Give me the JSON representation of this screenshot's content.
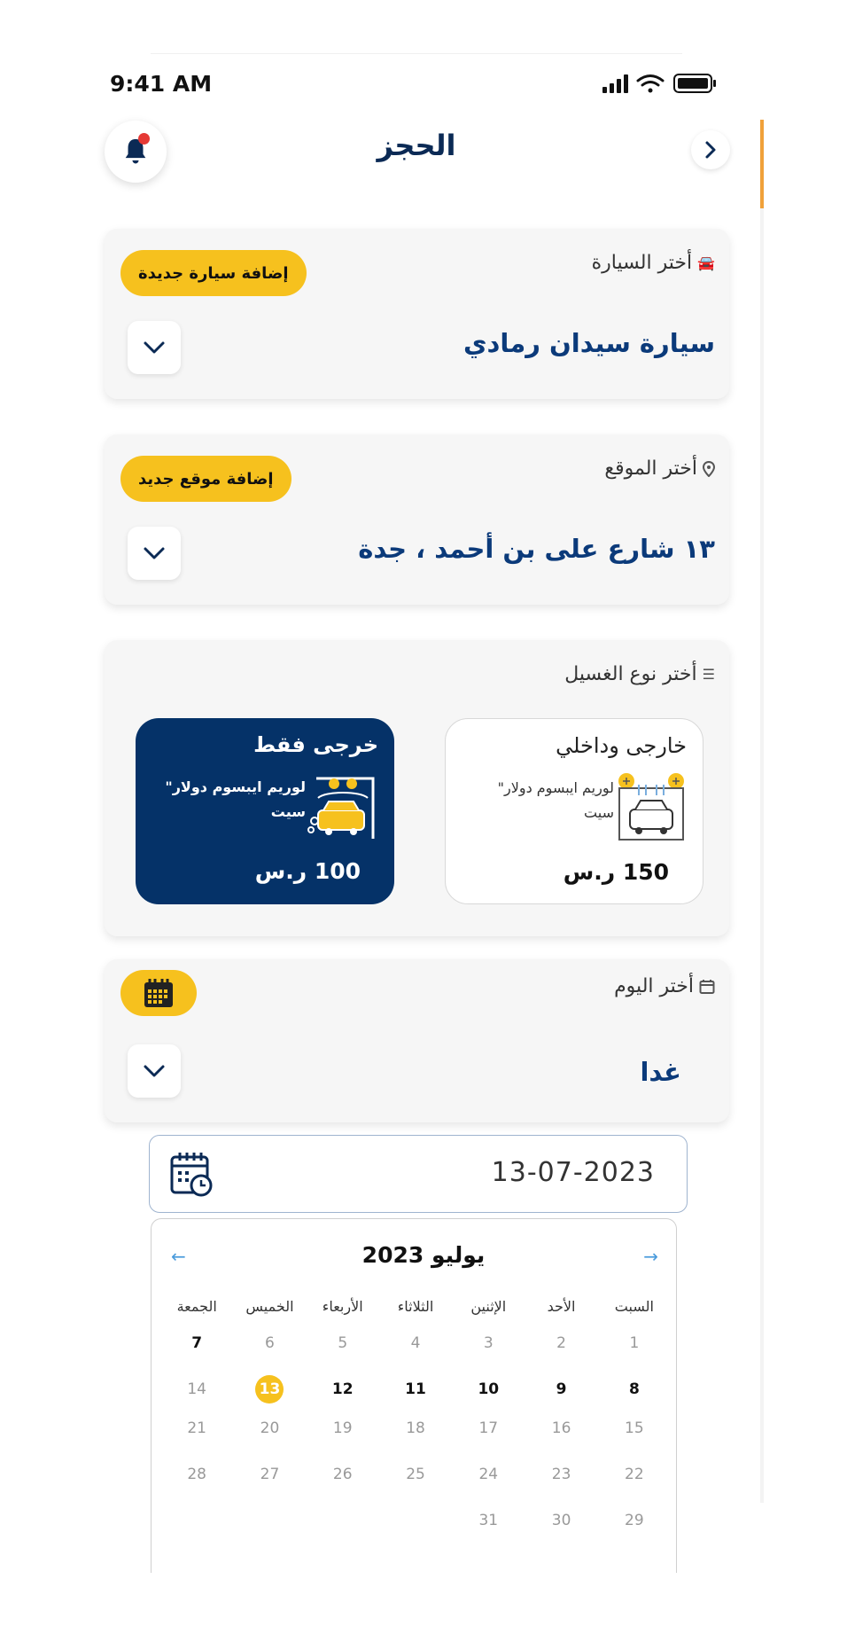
{
  "status_bar": {
    "time": "9:41 AM"
  },
  "header": {
    "title": "الحجز"
  },
  "car": {
    "label": "أختر السيارة",
    "add_label": "إضافة سيارة جديدة",
    "value": "سيارة سيدان رمادي"
  },
  "location": {
    "label": "أختر الموقع",
    "add_label": "إضافة موقع جديد",
    "value": "١٣ شارع على بن أحمد ، جدة"
  },
  "wash_type": {
    "label": "أختر نوع الغسيل",
    "options": [
      {
        "title": "خارجى  وداخلي",
        "desc": "لوريم ايبسوم دولار\" سيت",
        "price": "150 ر.س",
        "selected": false
      },
      {
        "title": "خرجى فقط",
        "desc": "لوريم ايبسوم دولار\" سيت",
        "price": "100 ر.س",
        "selected": true
      }
    ]
  },
  "day": {
    "label": "أختر اليوم",
    "value": "غدا"
  },
  "date_field": {
    "value": "13-07-2023"
  },
  "calendar": {
    "month": "يوليو",
    "year": "2023",
    "weekdays": [
      "السبت",
      "الأحد",
      "الإثنين",
      "الثلاثاء",
      "الأربعاء",
      "الخميس",
      "الجمعة"
    ],
    "weeks": [
      [
        "1",
        "2",
        "3",
        "4",
        "5",
        "6",
        "7"
      ],
      [
        "8",
        "9",
        "10",
        "11",
        "12",
        "13",
        "14"
      ],
      [
        "15",
        "16",
        "17",
        "18",
        "19",
        "20",
        "21"
      ],
      [
        "22",
        "23",
        "24",
        "25",
        "26",
        "27",
        "28"
      ],
      [
        "29",
        "30",
        "31",
        "",
        "",
        "",
        ""
      ]
    ],
    "selected_day": "13"
  },
  "colors": {
    "primary": "#053268",
    "accent": "#f6c11e",
    "notification": "#e53935"
  }
}
